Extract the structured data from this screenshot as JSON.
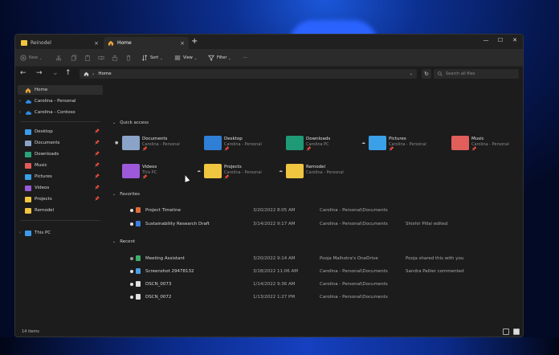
{
  "tabs": [
    {
      "label": "Reinodel",
      "close": "×"
    },
    {
      "label": "Home",
      "close": "×"
    }
  ],
  "new_tab": "+",
  "window_controls": {
    "minimize": "—",
    "maximize": "☐",
    "close": "✕"
  },
  "toolbar": {
    "new": "New",
    "sort": "Sort",
    "view": "View",
    "filter": "Filter",
    "more": "···",
    "chevron": "⌄"
  },
  "address": {
    "back": "←",
    "forward": "→",
    "up": "↑",
    "breadcrumb": "Home",
    "sep": "›",
    "chevron": "⌄",
    "refresh": "↻",
    "search_placeholder": "Search all files"
  },
  "sidebar": {
    "items": [
      {
        "label": "Home",
        "color": "#e8a33b"
      },
      {
        "label": "Carolina - Personal",
        "color": "#2f8ae0"
      },
      {
        "label": "Carolina - Contoso",
        "color": "#2f8ae0"
      },
      {
        "label": "Desktop",
        "color": "#3b9bea"
      },
      {
        "label": "Documents",
        "color": "#8aa3c7"
      },
      {
        "label": "Downloads",
        "color": "#2aa37a"
      },
      {
        "label": "Music",
        "color": "#e35b5b"
      },
      {
        "label": "Pictures",
        "color": "#3aa1e8"
      },
      {
        "label": "Videos",
        "color": "#9a5bd8"
      },
      {
        "label": "Projects",
        "color": "#f0c640"
      },
      {
        "label": "Remodel",
        "color": "#f0c640"
      },
      {
        "label": "This PC",
        "color": "#3b9bea"
      }
    ],
    "pin": "📌",
    "expand": "›"
  },
  "quick_access": {
    "title": "Quick access",
    "items": [
      {
        "name": "Documents",
        "sub": "Carolina - Personal",
        "color": "#8aa3c7"
      },
      {
        "name": "Desktop",
        "sub": "Carolina - Personal",
        "color": "#2f7fd6"
      },
      {
        "name": "Downloads",
        "sub": "Carolina PC",
        "color": "#1f9a76"
      },
      {
        "name": "Pictures",
        "sub": "Carolina - Personal",
        "color": "#3aa1e8"
      },
      {
        "name": "Music",
        "sub": "Carolina - Personal",
        "color": "#e05f5a"
      },
      {
        "name": "Videos",
        "sub": "This PC",
        "color": "#9d59d9"
      },
      {
        "name": "Projects",
        "sub": "Carolina - Personal",
        "color": "#f0c640"
      },
      {
        "name": "Remodel",
        "sub": "Carolina - Personal",
        "color": "#f0c640"
      }
    ]
  },
  "favorites": {
    "title": "Favorites",
    "rows": [
      {
        "name": "Project Timeline",
        "date": "3/20/2022 8:05 AM",
        "location": "Carolina - Personal\\Documents",
        "activity": "",
        "color": "#e06b3a"
      },
      {
        "name": "Sustainability Research Draft",
        "date": "3/14/2022 9:17 AM",
        "location": "Carolina - Personal\\Documents",
        "activity": "Shishir Pillai edited",
        "color": "#3a7ee0"
      }
    ]
  },
  "recent": {
    "title": "Recent",
    "rows": [
      {
        "name": "Meeting Assistant",
        "date": "3/20/2022 9:14 AM",
        "location": "Pooja Malhotra's OneDrive",
        "activity": "Pooja shared this with you",
        "color": "#3ab06a"
      },
      {
        "name": "Screenshot 29478132",
        "date": "3/18/2022 11:06 AM",
        "location": "Carolina - Personal\\Documents",
        "activity": "Sandra Pallier commented",
        "color": "#4aa0e0"
      },
      {
        "name": "DSCN_0073",
        "date": "1/14/2022 9:36 AM",
        "location": "Carolina - Personal\\Documents",
        "activity": "",
        "color": "#e0e0e0"
      },
      {
        "name": "DSCN_0072",
        "date": "1/13/2022 1:27 PM",
        "location": "Carolina - Personal\\Documents",
        "activity": "",
        "color": "#e0e0e0"
      }
    ]
  },
  "status": "14 items"
}
